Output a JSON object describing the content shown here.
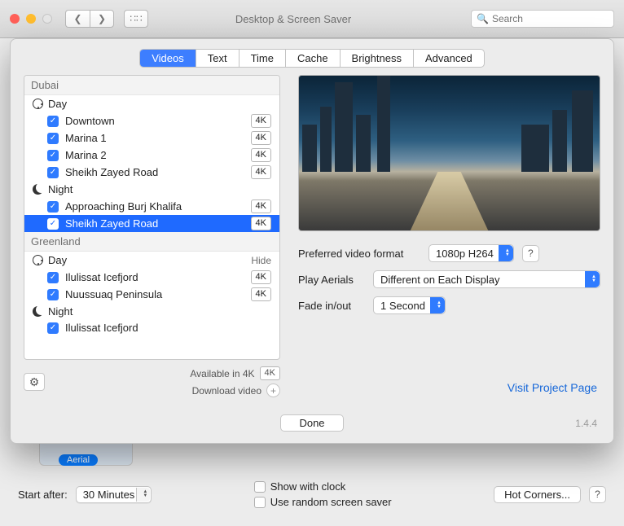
{
  "window": {
    "title": "Desktop & Screen Saver",
    "search_placeholder": "Search"
  },
  "sheet": {
    "tabs": [
      "Videos",
      "Text",
      "Time",
      "Cache",
      "Brightness",
      "Advanced"
    ],
    "active_tab": "Videos",
    "regions": [
      {
        "name": "Dubai",
        "groups": [
          {
            "kind": "Day",
            "label": "Day",
            "hide": null,
            "items": [
              {
                "label": "Downtown",
                "badge": "4K",
                "checked": true
              },
              {
                "label": "Marina 1",
                "badge": "4K",
                "checked": true
              },
              {
                "label": "Marina 2",
                "badge": "4K",
                "checked": true
              },
              {
                "label": "Sheikh Zayed Road",
                "badge": "4K",
                "checked": true
              }
            ]
          },
          {
            "kind": "Night",
            "label": "Night",
            "hide": null,
            "items": [
              {
                "label": "Approaching Burj Khalifa",
                "badge": "4K",
                "checked": true
              },
              {
                "label": "Sheikh Zayed Road",
                "badge": "4K",
                "checked": true,
                "selected": true
              }
            ]
          }
        ]
      },
      {
        "name": "Greenland",
        "groups": [
          {
            "kind": "Day",
            "label": "Day",
            "hide": "Hide",
            "items": [
              {
                "label": "Ilulissat Icefjord",
                "badge": "4K",
                "checked": true
              },
              {
                "label": "Nuussuaq Peninsula",
                "badge": "4K",
                "checked": true
              }
            ]
          },
          {
            "kind": "Night",
            "label": "Night",
            "hide": null,
            "items": [
              {
                "label": "Ilulissat Icefjord",
                "badge": null,
                "checked": true
              }
            ]
          }
        ]
      }
    ],
    "under_tree": {
      "available_label": "Available in 4K",
      "available_badge": "4K",
      "download_label": "Download video"
    },
    "options": {
      "format_label": "Preferred video format",
      "format_value": "1080p H264",
      "play_label": "Play Aerials",
      "play_value": "Different on Each Display",
      "fade_label": "Fade in/out",
      "fade_value": "1 Second"
    },
    "help": "?",
    "visit": "Visit Project Page",
    "done": "Done",
    "version": "1.4.4"
  },
  "bg": {
    "badge": "Aerial",
    "start_after_label": "Start after:",
    "start_after_value": "30 Minutes",
    "show_clock": "Show with clock",
    "random": "Use random screen saver",
    "hot_corners": "Hot Corners...",
    "help": "?"
  }
}
